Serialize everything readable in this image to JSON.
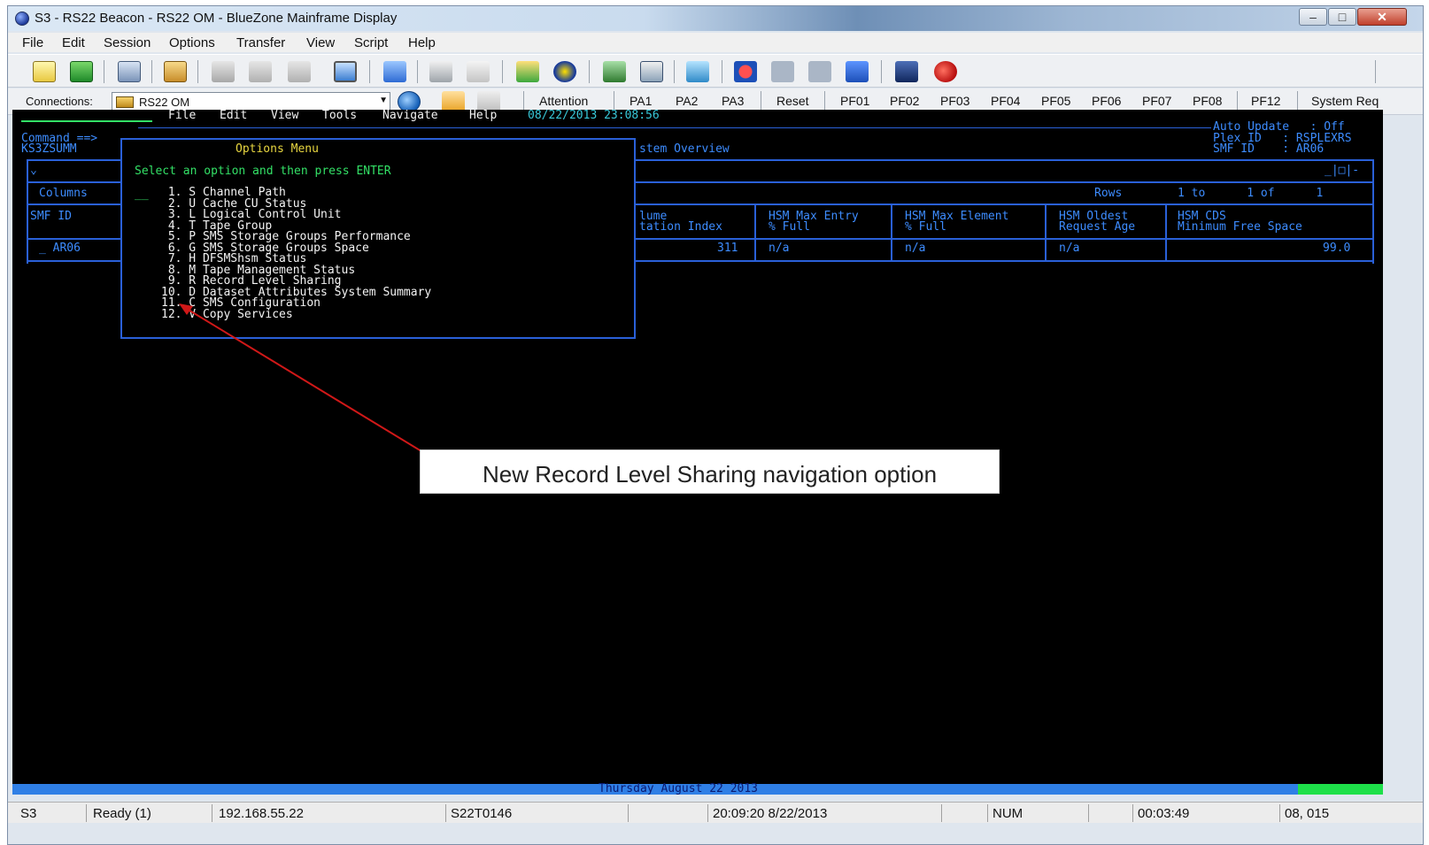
{
  "window": {
    "title": "S3 - RS22 Beacon - RS22 OM - BlueZone Mainframe Display"
  },
  "menubar": [
    "File",
    "Edit",
    "Session",
    "Options",
    "Transfer",
    "View",
    "Script",
    "Help"
  ],
  "toolbar_icons": [
    "new-session-icon",
    "save-icon",
    "screen-print-icon",
    "open-folder-icon",
    "cut-icon",
    "copy-icon",
    "paste-icon",
    "host-connect-icon",
    "network-icon",
    "keyboard-icon",
    "grid-icon",
    "chart-icon",
    "browser-icon",
    "display-icon",
    "field-icon",
    "transfer-icon",
    "record-icon",
    "stop-icon",
    "pause-icon",
    "play-icon",
    "book-icon",
    "apple-icon"
  ],
  "connections": {
    "label": "Connections:",
    "selected": "RS22 OM",
    "buttons": [
      "Attention",
      "PA1",
      "PA2",
      "PA3",
      "Reset",
      "PF01",
      "PF02",
      "PF03",
      "PF04",
      "PF05",
      "PF06",
      "PF07",
      "PF08",
      "PF12",
      "System Req"
    ]
  },
  "terminal": {
    "menu": [
      "File",
      "Edit",
      "View",
      "Tools",
      "Navigate",
      "Help"
    ],
    "datetime": "08/22/2013 23:08:56",
    "command_label": "Command ==>",
    "panel_id": "KS3ZSUMM",
    "auto_update": "Auto Update   : Off",
    "plex_id": "Plex ID   : RSPLEXRS",
    "smf_id": "SMF ID    : AR06",
    "window_title_fragment": "stem Overview",
    "window_ctrls": "_|□|-",
    "columns_label": "Columns",
    "rows_label": "Rows",
    "rows_range": "1 to      1 of      1",
    "smf_header": "SMF ID",
    "smf_value": "_ AR06",
    "headers": [
      {
        "line1": "lume",
        "line2": "tation Index"
      },
      {
        "line1": "HSM Max Entry",
        "line2": "% Full"
      },
      {
        "line1": "HSM Max Element",
        "line2": "% Full"
      },
      {
        "line1": "HSM Oldest",
        "line2": "Request Age"
      },
      {
        "line1": "HSM CDS",
        "line2": "Minimum Free Space"
      }
    ],
    "row": [
      "311",
      "n/a",
      "n/a",
      "n/a",
      "99.0"
    ],
    "options_menu": {
      "title": "Options Menu",
      "instruction": "Select an option and then press ENTER",
      "input": "__",
      "items": [
        " 1. S Channel Path",
        " 2. U Cache CU Status",
        " 3. L Logical Control Unit",
        " 4. T Tape Group",
        " 5. P SMS Storage Groups Performance",
        " 6. G SMS Storage Groups Space",
        " 7. H DFSMShsm Status",
        " 8. M Tape Management Status",
        " 9. R Record Level Sharing",
        "10. D Dataset Attributes System Summary",
        "11. C SMS Configuration",
        "12. V Copy Services"
      ]
    },
    "date_strip": "Thursday August 22 2013"
  },
  "statusbar": [
    "S3",
    "Ready (1)",
    "192.168.55.22",
    "S22T0146",
    "20:09:20 8/22/2013",
    "NUM",
    "00:03:49",
    "08, 015"
  ],
  "callout": "New Record Level Sharing navigation option",
  "colors": {
    "terminal_bg": "#000000",
    "terminal_blue": "#3d8cff",
    "terminal_white": "#f4f4f4",
    "terminal_yellow": "#e8d640",
    "terminal_green": "#33e066",
    "callout_arrow": "#d01818"
  }
}
